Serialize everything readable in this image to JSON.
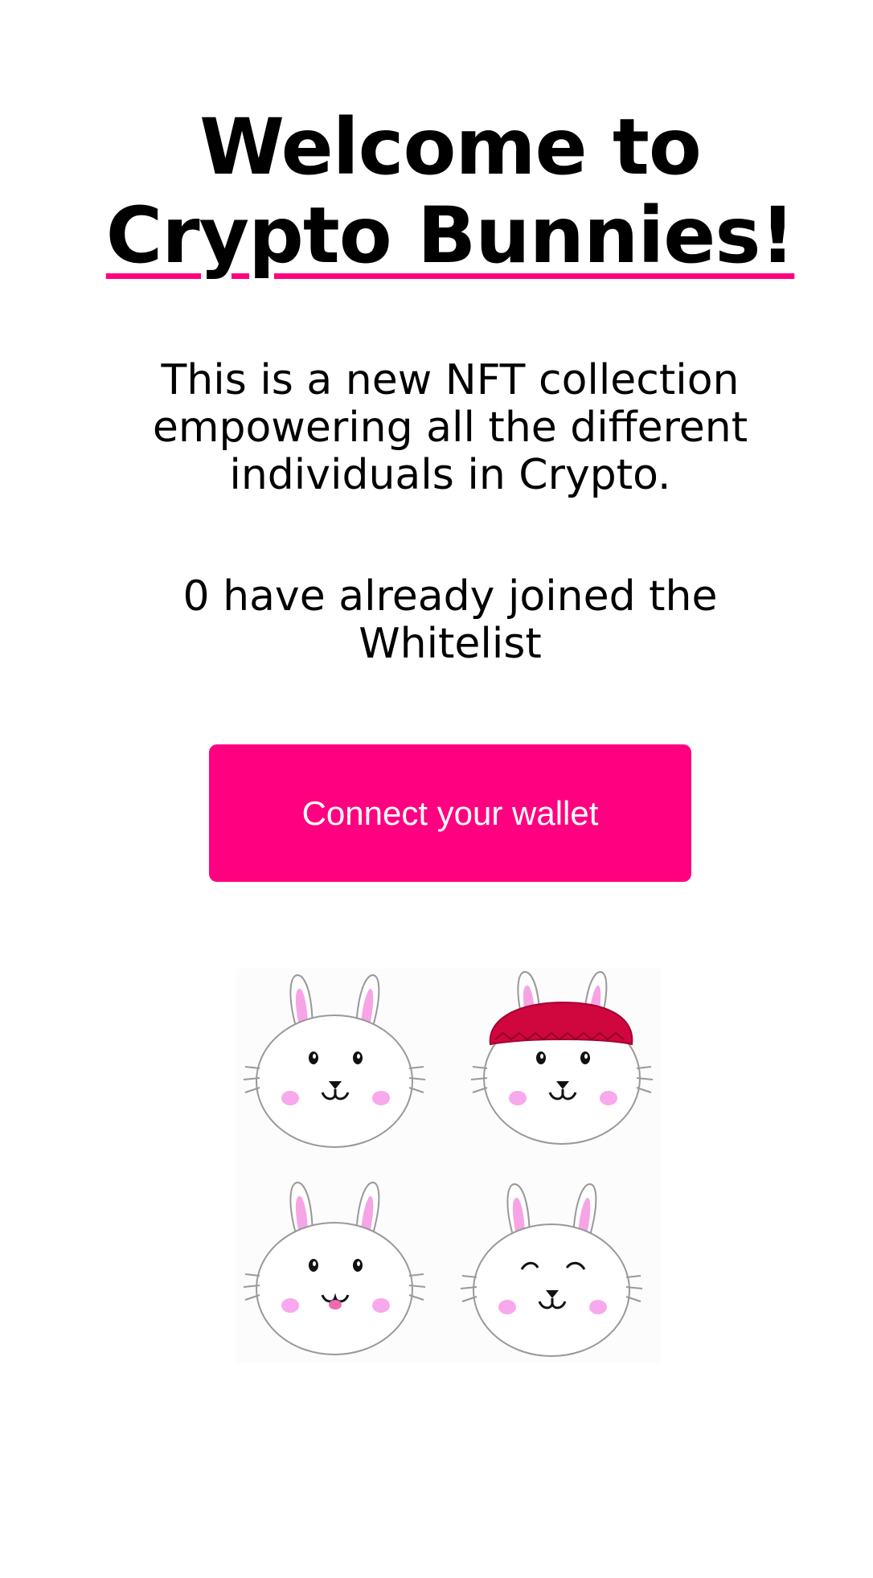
{
  "header": {
    "title_prefix": "Welcome to ",
    "title_brand": "Crypto Bunnies!"
  },
  "main": {
    "description": "This is a new NFT collection empowering all the different individuals in Crypto.",
    "whitelist_text": "0 have already joined the Whitelist",
    "connect_label": "Connect your wallet"
  },
  "colors": {
    "accent": "#ff0080",
    "background": "#ffffff",
    "text": "#000000"
  },
  "images": {
    "bunnies": [
      "bunny-face-icon",
      "bunny-with-hat-icon",
      "bunny-tongue-icon",
      "bunny-smiling-icon"
    ]
  }
}
